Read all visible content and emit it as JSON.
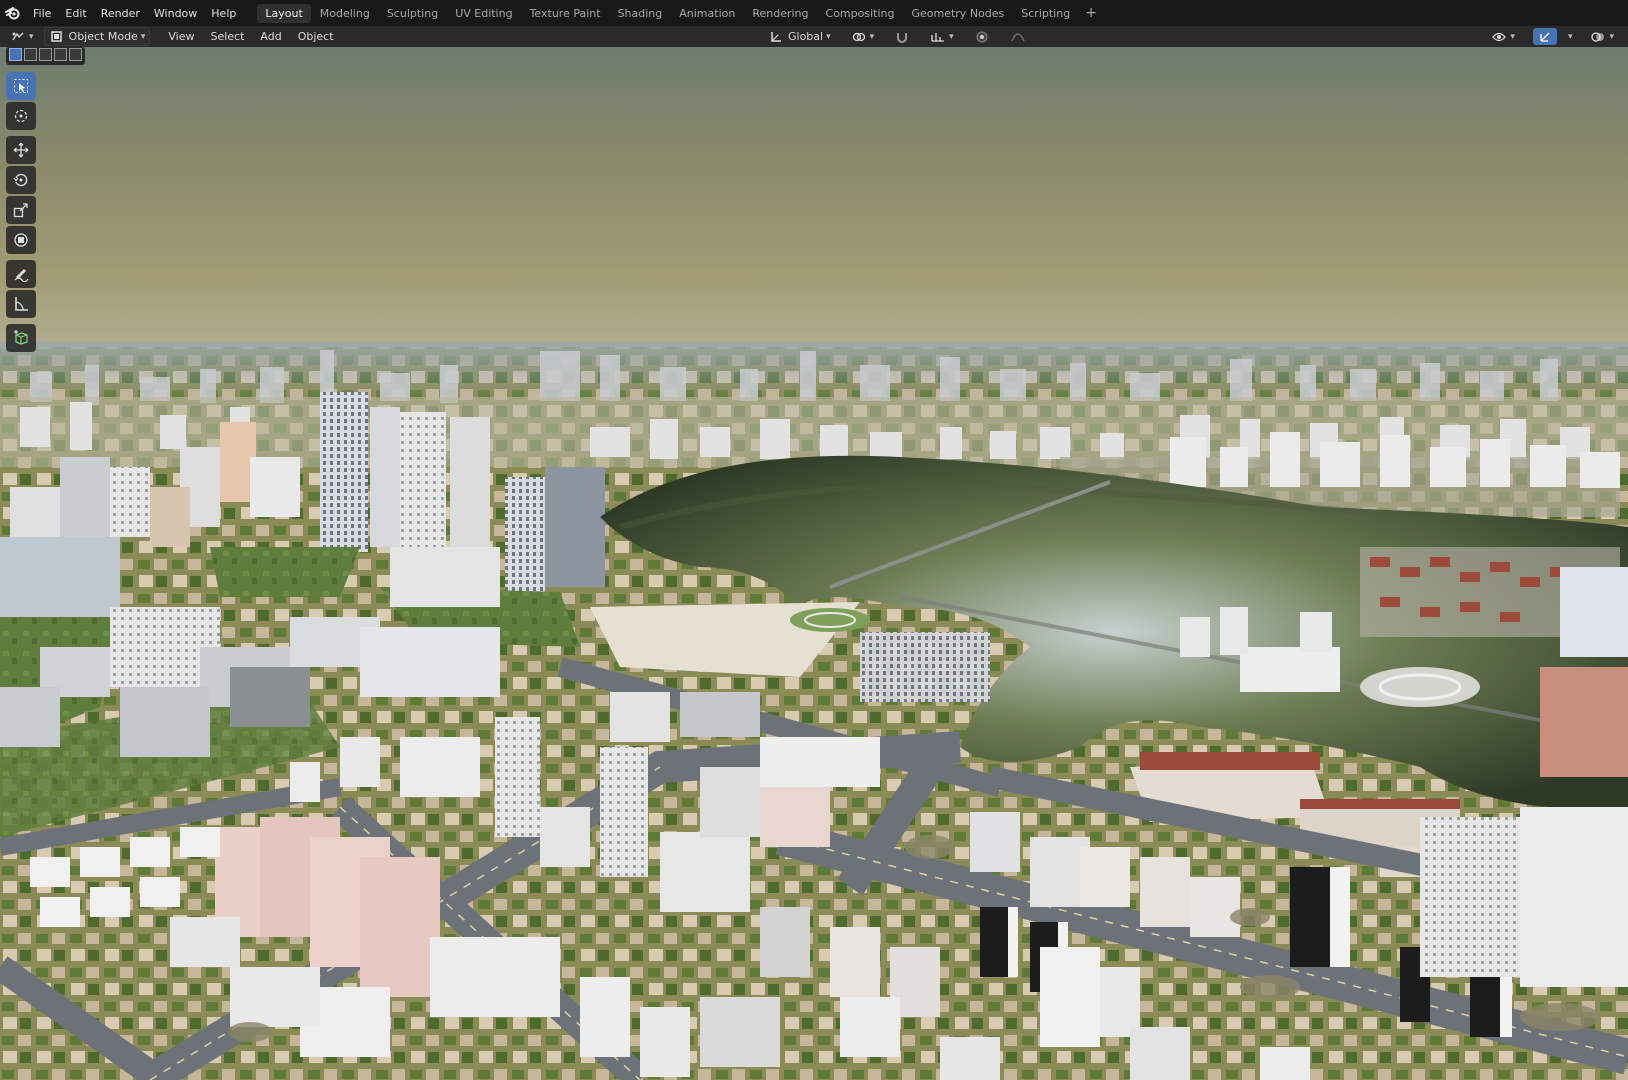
{
  "app": {
    "menu": [
      "File",
      "Edit",
      "Render",
      "Window",
      "Help"
    ]
  },
  "workspaces": {
    "tabs": [
      "Layout",
      "Modeling",
      "Sculpting",
      "UV Editing",
      "Texture Paint",
      "Shading",
      "Animation",
      "Rendering",
      "Compositing",
      "Geometry Nodes",
      "Scripting"
    ],
    "active": "Layout",
    "add_label": "+"
  },
  "header": {
    "mode_label": "Object Mode",
    "menus": [
      "View",
      "Select",
      "Add",
      "Object"
    ],
    "orientation_label": "Global"
  },
  "toolbar": {
    "tools": [
      {
        "name": "select-box-icon",
        "active": true
      },
      {
        "name": "cursor-icon",
        "active": false
      },
      {
        "name": "move-icon",
        "active": false
      },
      {
        "name": "rotate-icon",
        "active": false
      },
      {
        "name": "scale-icon",
        "active": false
      },
      {
        "name": "transform-icon",
        "active": false
      },
      {
        "name": "annotate-icon",
        "active": false
      },
      {
        "name": "measure-icon",
        "active": false
      },
      {
        "name": "add-cube-icon",
        "active": false
      }
    ]
  },
  "colors": {
    "accent": "#4772b3",
    "topbar": "#181818",
    "header": "#2a2a2a"
  }
}
